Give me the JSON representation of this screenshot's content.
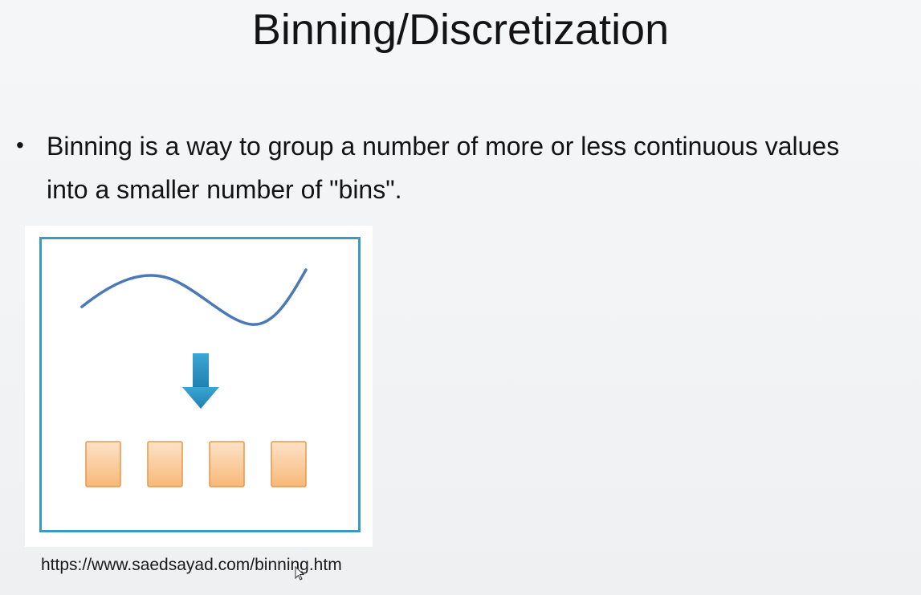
{
  "slide": {
    "title": "Binning/Discretization",
    "bullets": [
      {
        "line1": "Binning is a way to group a number of more or less continuous values",
        "line2": "into a smaller number of \"bins\"."
      }
    ],
    "source_url": "https://www.saedsayad.com/binning.htm"
  },
  "figure": {
    "frame_color": "#3a9ac2",
    "curve_color": "#4a78b8",
    "arrow_color": "#2a8fc0",
    "bin_fill_top": "#fde3c8",
    "bin_fill_bottom": "#f7b878",
    "bin_stroke": "#e8964a",
    "bin_count": 4
  }
}
